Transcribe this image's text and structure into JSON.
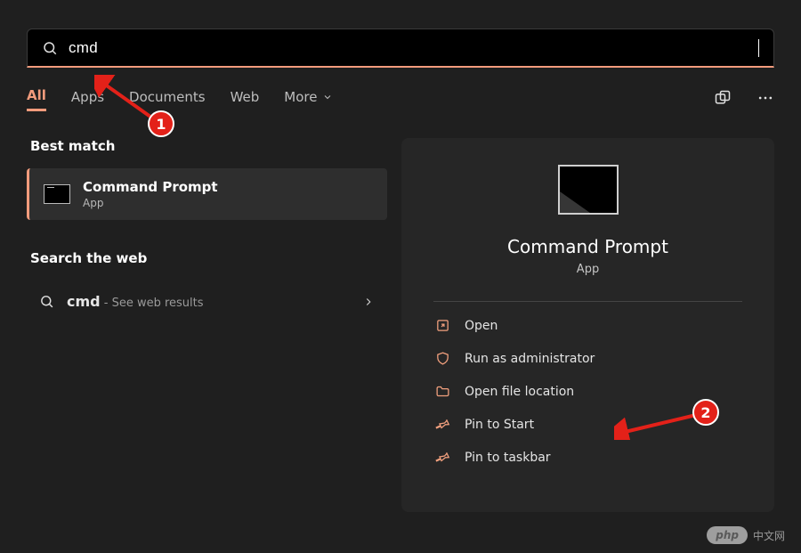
{
  "search": {
    "value": "cmd"
  },
  "tabs": {
    "all": "All",
    "apps": "Apps",
    "documents": "Documents",
    "web": "Web",
    "more": "More"
  },
  "left": {
    "best_match_header": "Best match",
    "best_item_title": "Command Prompt",
    "best_item_sub": "App",
    "search_web_header": "Search the web",
    "web_item_term": "cmd",
    "web_item_suffix": " - See web results"
  },
  "right": {
    "title": "Command Prompt",
    "sub": "App",
    "actions": {
      "open": "Open",
      "run_admin": "Run as administrator",
      "open_location": "Open file location",
      "pin_start": "Pin to Start",
      "pin_taskbar": "Pin to taskbar"
    }
  },
  "annotations": {
    "one": "1",
    "two": "2"
  },
  "watermark": {
    "brand": "php",
    "cn": "中文网"
  }
}
